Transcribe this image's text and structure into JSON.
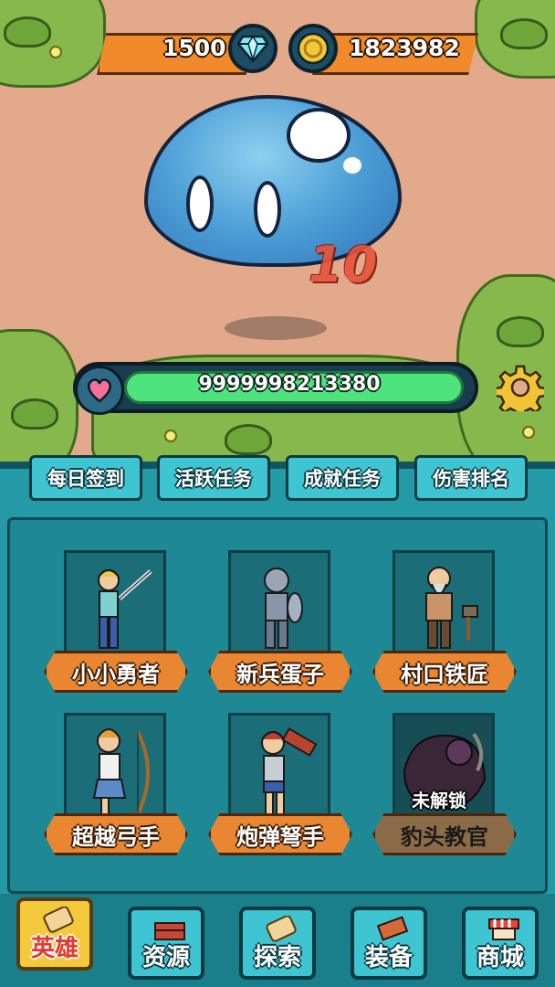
{
  "currency": {
    "gems": "1500",
    "coins": "1823982",
    "gem_icon": "diamond-icon",
    "coin_icon": "coin-icon"
  },
  "enemy": {
    "name": "slime",
    "damage_popup": "10",
    "hp": "9999998213380",
    "hp_fraction": 0.99
  },
  "task_tabs": [
    {
      "label": "每日签到"
    },
    {
      "label": "活跃任务"
    },
    {
      "label": "成就任务"
    },
    {
      "label": "伤害排名"
    }
  ],
  "heroes": [
    {
      "name": "小小勇者",
      "locked": false
    },
    {
      "name": "新兵蛋子",
      "locked": false
    },
    {
      "name": "村口铁匠",
      "locked": false
    },
    {
      "name": "超越弓手",
      "locked": false
    },
    {
      "name": "炮弹弩手",
      "locked": false
    },
    {
      "name": "豹头教官",
      "locked": true,
      "lock_label": "未解锁"
    }
  ],
  "nav": [
    {
      "label": "英雄",
      "active": true
    },
    {
      "label": "资源",
      "active": false
    },
    {
      "label": "探索",
      "active": false
    },
    {
      "label": "装备",
      "active": false
    },
    {
      "label": "商城",
      "active": false
    }
  ],
  "colors": {
    "ground": "#e2a98a",
    "panel": "#239aa6",
    "ribbon": "#e88632",
    "hp_fill": "#4fe37e",
    "currency_bar": "#f08a2a"
  }
}
